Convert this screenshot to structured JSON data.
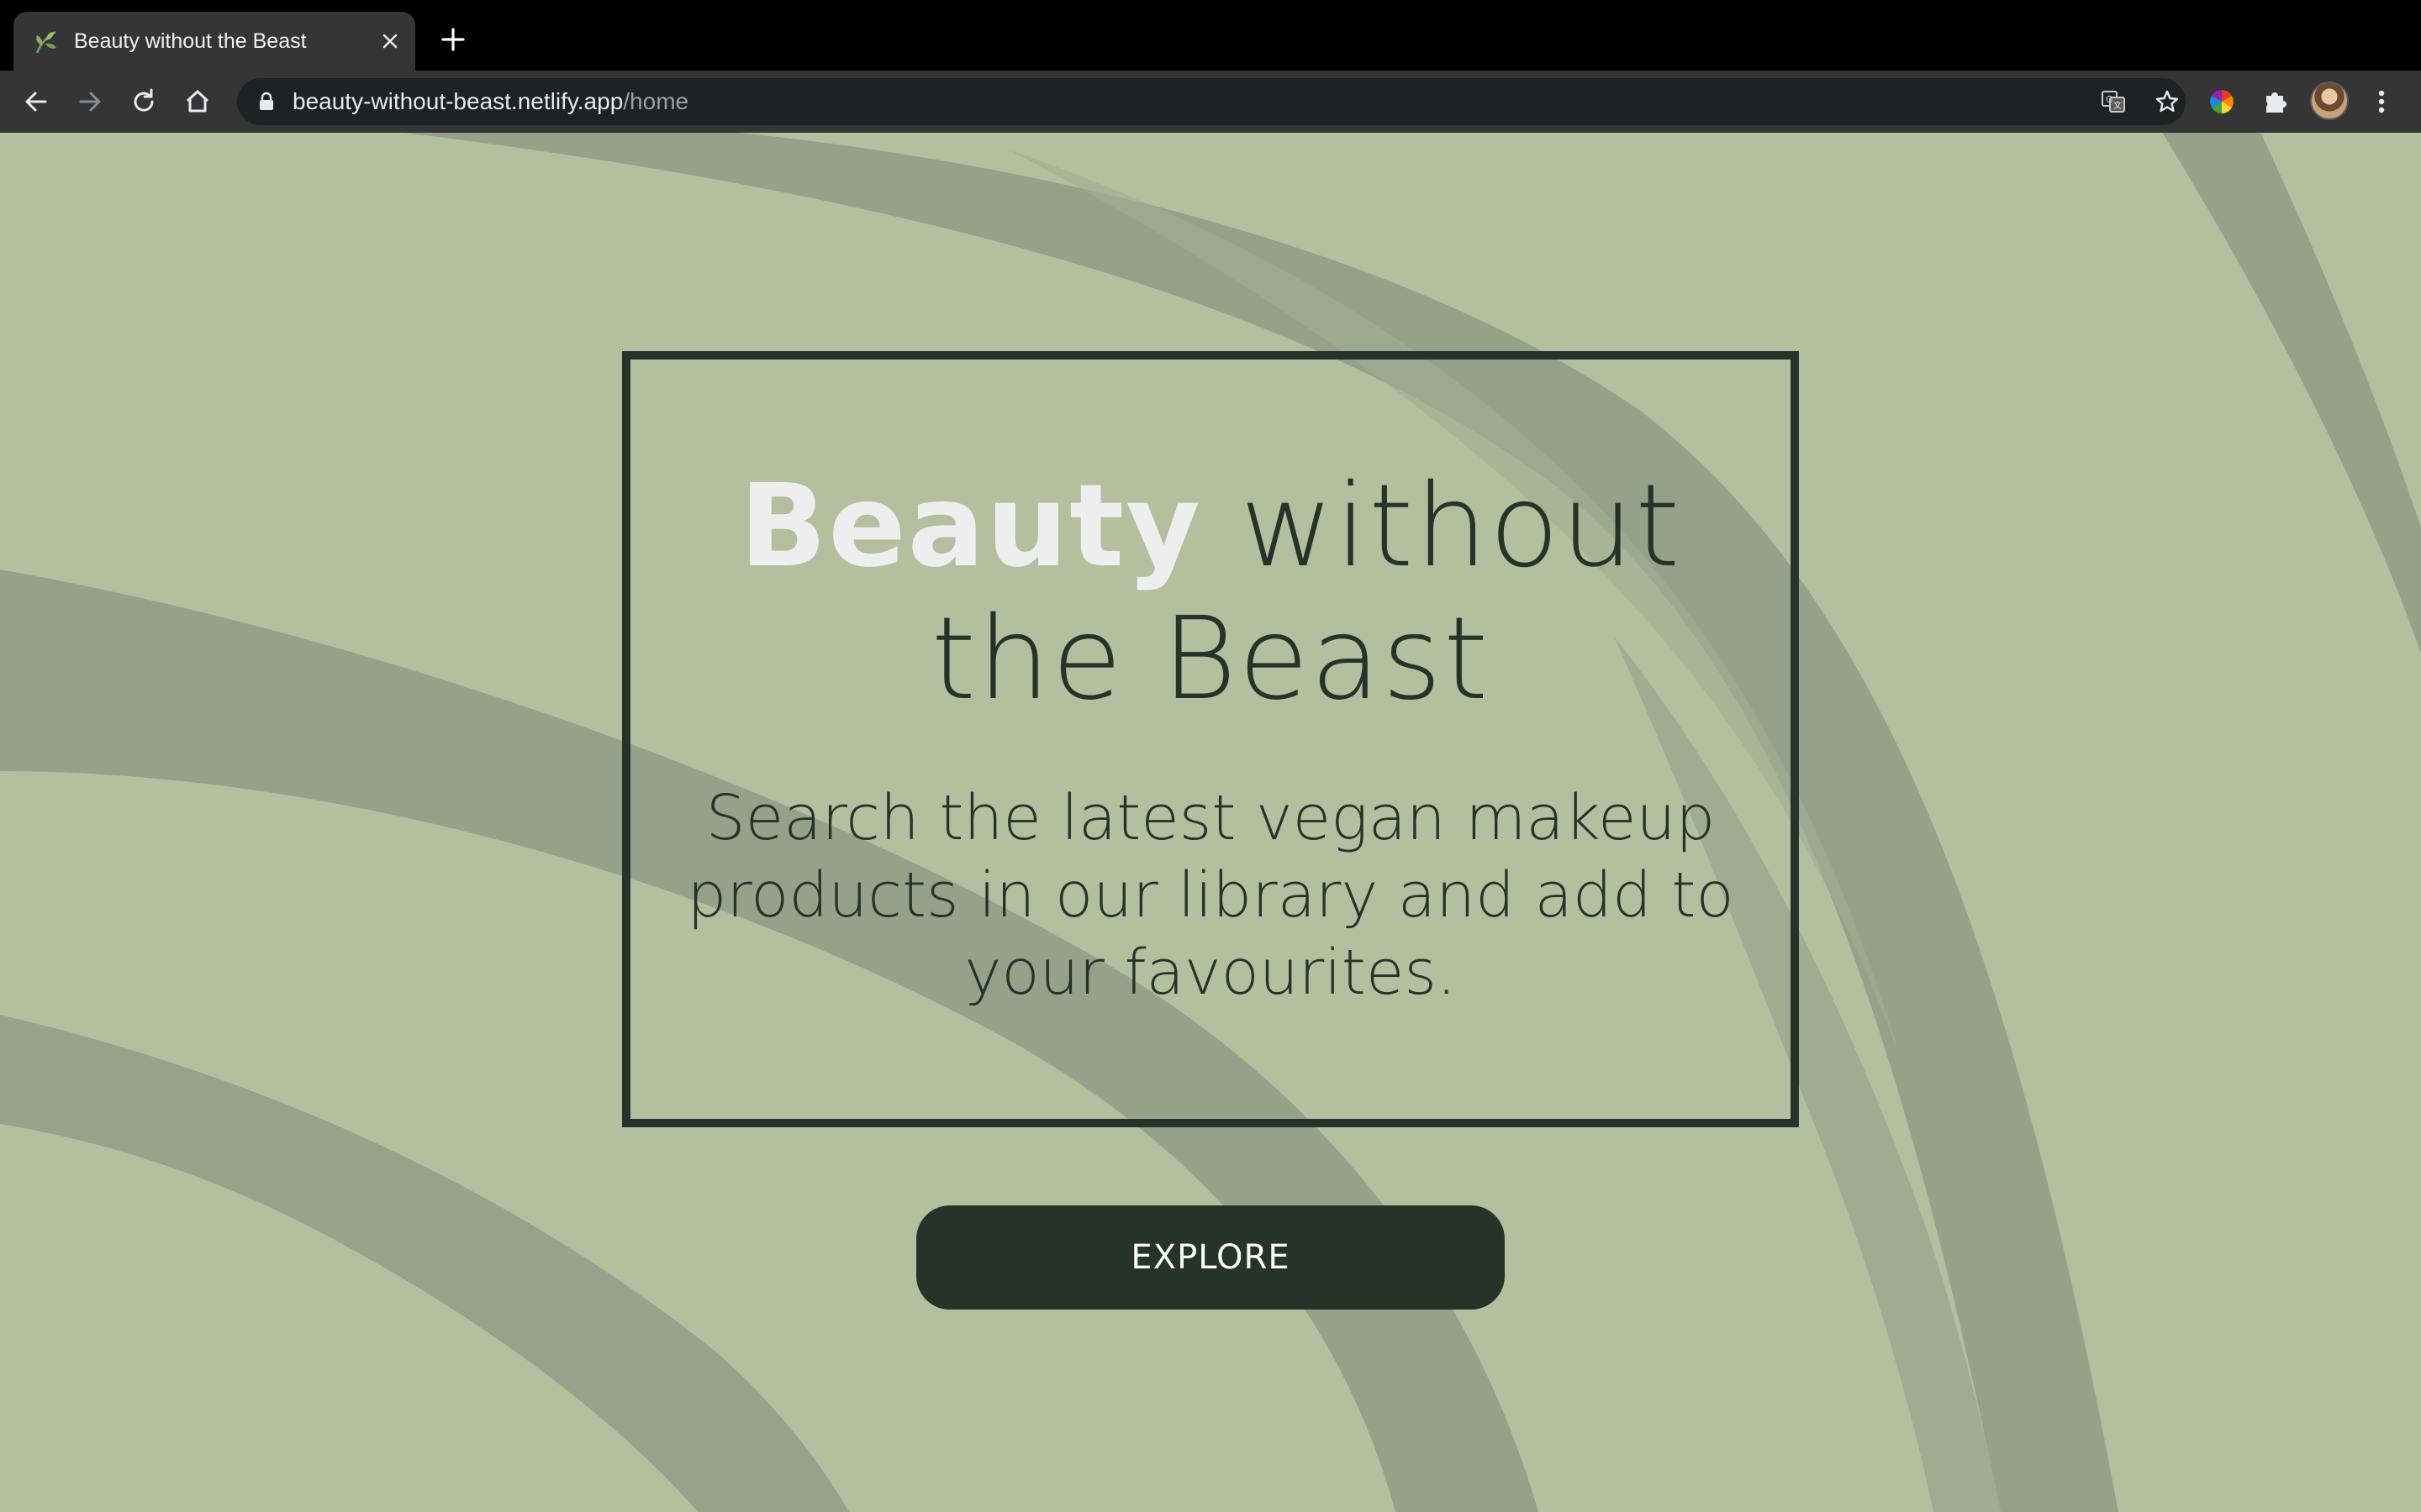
{
  "browser": {
    "tab_title": "Beauty without the Beast",
    "url_host": "beauty-without-beast.netlify.app",
    "url_path": "/home",
    "icons": {
      "back": "arrow-left-icon",
      "forward": "arrow-right-icon",
      "reload": "reload-icon",
      "home": "home-icon",
      "lock": "lock-icon",
      "translate": "translate-icon",
      "bookmark": "star-icon",
      "extension_color": "color-wheel-icon",
      "extensions": "puzzle-icon",
      "menu": "kebab-menu-icon"
    }
  },
  "hero": {
    "title_accent": "Beauty",
    "title_rest": "without the Beast",
    "subtitle": "Search the latest vegan makeup products in our library and add to your favourites.",
    "cta_label": "EXPLORE"
  },
  "colors": {
    "background": "#b4bf9f",
    "dark_green": "#253329",
    "accent_text": "#eeeeee",
    "leaf_shadow": "#8f9b85"
  }
}
